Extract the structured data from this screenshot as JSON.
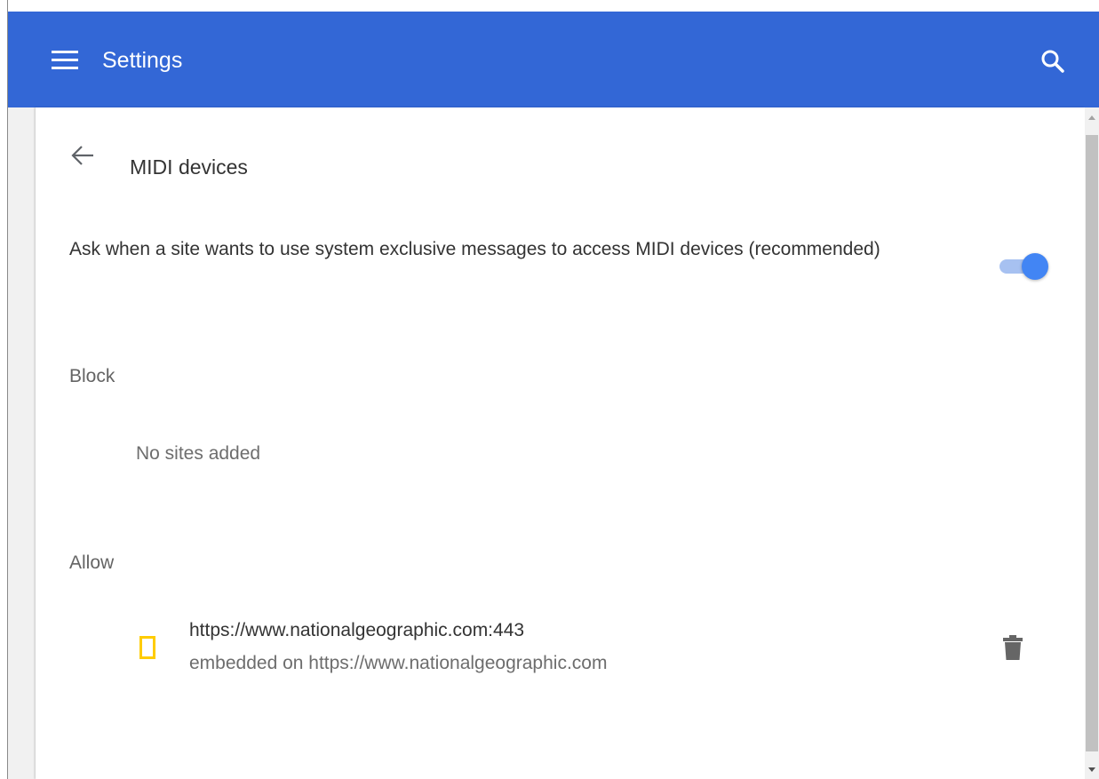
{
  "toolbar": {
    "title": "Settings",
    "menu_icon": "hamburger-menu-icon",
    "search_icon": "search-icon",
    "background_color": "#3367d6"
  },
  "subpage": {
    "back_icon": "arrow-back-icon",
    "title": "MIDI devices"
  },
  "ask_setting": {
    "label": "Ask when a site wants to use system exclusive messages to access MIDI devices (recommended)",
    "enabled": true,
    "accent_color": "#4285f4"
  },
  "block": {
    "heading": "Block",
    "empty_text": "No sites added"
  },
  "allow": {
    "heading": "Allow",
    "sites": [
      {
        "url": "https://www.nationalgeographic.com:443",
        "embedded": "embedded on https://www.nationalgeographic.com",
        "favicon": "national-geographic-favicon",
        "favicon_color": "#ffcc00",
        "delete_icon": "trash-icon"
      }
    ]
  }
}
